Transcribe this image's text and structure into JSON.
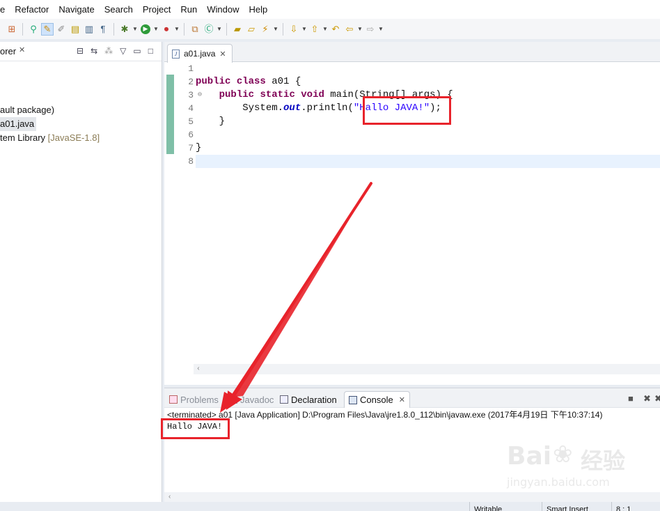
{
  "menu": [
    "e",
    "Refactor",
    "Navigate",
    "Search",
    "Project",
    "Run",
    "Window",
    "Help"
  ],
  "explorer": {
    "title": "orer",
    "tree": [
      {
        "label": "ault package)",
        "suffix": ""
      },
      {
        "label": "a01.java",
        "suffix": ""
      },
      {
        "label": "tem Library ",
        "suffix": "[JavaSE-1.8]"
      }
    ]
  },
  "editor": {
    "tab_label": "a01.java",
    "line_numbers": [
      "1",
      "2",
      "3",
      "4",
      "5",
      "6",
      "7",
      "8"
    ],
    "code": {
      "kw_public": "public",
      "kw_class": "class",
      "class_name": " a01 {",
      "kw_public2": "public",
      "kw_static": "static",
      "kw_void": "void",
      "main_sig": " main(String[] args) {",
      "sysout": "System.",
      "out": "out",
      "println": ".println(",
      "string": "\"Hallo JAVA!\"",
      "end": ");",
      "close_inner": "}",
      "close_outer": "}"
    }
  },
  "console": {
    "tabs": [
      "Problems",
      "Javadoc",
      "Declaration",
      "Console"
    ],
    "header": "<terminated> a01 [Java Application] D:\\Program Files\\Java\\jre1.8.0_112\\bin\\javaw.exe (2017年4月19日 下午10:37:14)",
    "output": "Hallo JAVA!"
  },
  "status": {
    "writable": "Writable",
    "insert": "Smart Insert",
    "position": "8 : 1"
  },
  "watermark": {
    "brand": "Bai",
    "brand2": "经验",
    "url": "jingyan.baidu.com"
  },
  "colors": {
    "annotation": "#e8232b",
    "keyword": "#7f0055",
    "string": "#2a00ff"
  }
}
